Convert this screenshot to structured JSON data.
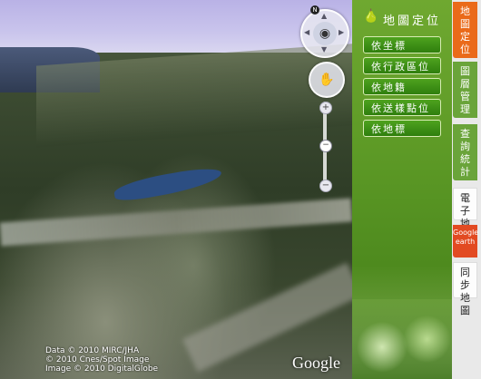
{
  "map": {
    "attribution": [
      "Data © 2010 MIRC/JHA",
      "© 2010 Cnes/Spot Image",
      "Image © 2010 DigitalGlobe"
    ],
    "logo": "Google",
    "compass_north": "N"
  },
  "panel": {
    "title": "地圖定位",
    "buttons": [
      "依坐標",
      "依行政區位",
      "依地籍",
      "依送樣點位",
      "依地標"
    ]
  },
  "tabs": [
    {
      "label": "地圖定位"
    },
    {
      "label": "圖層管理"
    },
    {
      "label": "查詢統計"
    },
    {
      "label": "電子地圖"
    },
    {
      "label": "Google earth"
    },
    {
      "label": "同步地圖"
    }
  ]
}
